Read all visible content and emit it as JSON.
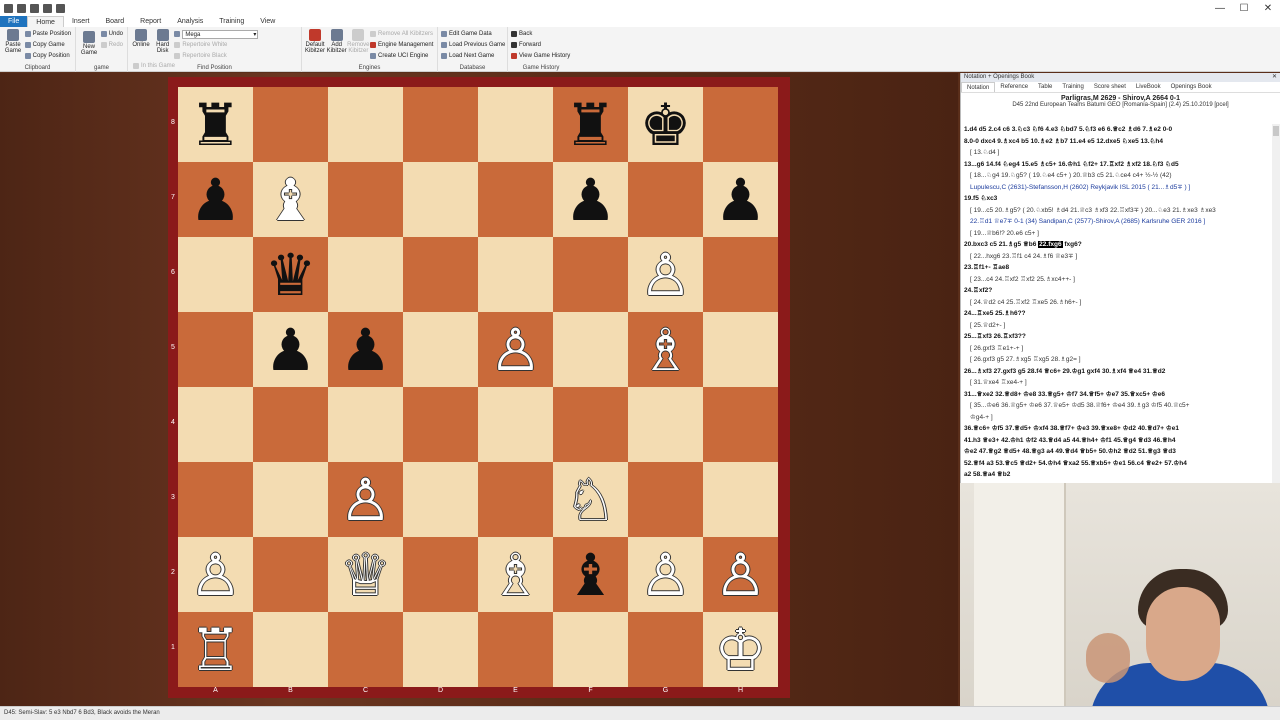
{
  "ribbon": {
    "tabs": [
      "File",
      "Home",
      "Insert",
      "Board",
      "Report",
      "Analysis",
      "Training",
      "View"
    ],
    "clipboard": {
      "paste_game": "Paste Game",
      "paste_position": "Paste Position",
      "copy_game": "Copy Game",
      "copy_position": "Copy Position",
      "label": "Clipboard"
    },
    "game": {
      "undo": "Undo",
      "redo": "Redo",
      "new_game": "New Game",
      "label": "game"
    },
    "find": {
      "online": "Online",
      "hard_disk": "Hard Disk",
      "database_select": "Mega",
      "in_this_game": "In this Game",
      "repertoire_white": "Repertoire White",
      "repertoire_black": "Repertoire Black",
      "label": "Find Position"
    },
    "engines": {
      "default_kibitzer": "Default Kibitzer",
      "add_kibitzer": "Add Kibitzer",
      "remove_kibitzer": "Remove Kibitzer",
      "remove_all": "Remove All Kibitzers",
      "engine_management": "Engine Management",
      "create_uci": "Create UCI Engine",
      "label": "Engines"
    },
    "database": {
      "edit_game_data": "Edit Game Data",
      "load_previous": "Load Previous Game",
      "load_next": "Load Next Game",
      "label": "Database"
    },
    "history": {
      "back": "Back",
      "forward": "Forward",
      "view_history": "View Game History",
      "label": "Game History"
    }
  },
  "board": {
    "ranks": [
      "8",
      "7",
      "6",
      "5",
      "4",
      "3",
      "2",
      "1"
    ],
    "files": [
      "A",
      "B",
      "C",
      "D",
      "E",
      "F",
      "G",
      "H"
    ],
    "pieces": [
      {
        "sq": "a8",
        "glyph": "♜",
        "color": "b"
      },
      {
        "sq": "f8",
        "glyph": "♜",
        "color": "b"
      },
      {
        "sq": "g8",
        "glyph": "♚",
        "color": "b"
      },
      {
        "sq": "a7",
        "glyph": "♟",
        "color": "b"
      },
      {
        "sq": "b7",
        "glyph": "♝",
        "color": "w"
      },
      {
        "sq": "f7",
        "glyph": "♟",
        "color": "b"
      },
      {
        "sq": "h7",
        "glyph": "♟",
        "color": "b"
      },
      {
        "sq": "b6",
        "glyph": "♛",
        "color": "b"
      },
      {
        "sq": "g6",
        "glyph": "♙",
        "color": "w"
      },
      {
        "sq": "b5",
        "glyph": "♟",
        "color": "b"
      },
      {
        "sq": "c5",
        "glyph": "♟",
        "color": "b"
      },
      {
        "sq": "e5",
        "glyph": "♙",
        "color": "w"
      },
      {
        "sq": "g5",
        "glyph": "♗",
        "color": "w"
      },
      {
        "sq": "c3",
        "glyph": "♙",
        "color": "w"
      },
      {
        "sq": "f3",
        "glyph": "♘",
        "color": "w"
      },
      {
        "sq": "a2",
        "glyph": "♙",
        "color": "w"
      },
      {
        "sq": "c2",
        "glyph": "♕",
        "color": "w"
      },
      {
        "sq": "e2",
        "glyph": "♗",
        "color": "w"
      },
      {
        "sq": "f2",
        "glyph": "♝",
        "color": "b"
      },
      {
        "sq": "g2",
        "glyph": "♙",
        "color": "w"
      },
      {
        "sq": "h2",
        "glyph": "♙",
        "color": "w"
      },
      {
        "sq": "a1",
        "glyph": "♖",
        "color": "w"
      },
      {
        "sq": "h1",
        "glyph": "♔",
        "color": "w"
      }
    ]
  },
  "notation": {
    "panel_title": "Notation + Openings Book",
    "tabs": [
      "Notation",
      "Reference",
      "Table",
      "Training",
      "Score sheet",
      "LiveBook",
      "Openings Book"
    ],
    "header": "Parligras,M 2629 - Shirov,A 2664  0-1",
    "event": "D45  22nd European Teams Batumi GEO [Romania-Spain] (2.4) 25.10.2019 [pcel]",
    "lines": [
      {
        "kind": "mv",
        "text": "1.d4  d5  2.c4  c6  3.♘c3  ♘f6  4.e3  ♘bd7  5.♘f3  e6  6.♕c2  ♗d6  7.♗e2  0-0"
      },
      {
        "kind": "mv",
        "text": "8.0-0  dxc4  9.♗xc4  b5  10.♗e2  ♗b7  11.e4  e5  12.dxe5  ♘xe5  13.♘h4"
      },
      {
        "kind": "var",
        "text": "[ 13.♘d4 ]"
      },
      {
        "kind": "mv",
        "text": "13...g6  14.f4  ♘eg4  15.e5  ♗c5+  16.♔h1  ♘f2+  17.♖xf2  ♗xf2  18.♘f3  ♘d5"
      },
      {
        "kind": "var",
        "text": "[ 18...♘g4  19.♘g5?  ( 19.♘e4  c5+ )  20.♕b3  c5  21.♘ce4  c4+ ½-½ (42)"
      },
      {
        "kind": "varblue",
        "text": "Lupulescu,C (2631)-Stefansson,H (2602) Reykjavik ISL 2015  ( 21...♗d5∓ ) ]"
      },
      {
        "kind": "mv",
        "text": "19.f5  ♘xc3"
      },
      {
        "kind": "var",
        "text": "[ 19...c5  20.♗g5?  ( 20.♘xb5!  ♗d4  21.♕c3  ♗xf3  22.♖xf3∓ )  20...♘e3  21.♗xe3  ♗xe3"
      },
      {
        "kind": "varblue",
        "text": "22.♖d1  ♕e7∓ 0-1 (34) Sandipan,C (2577)-Shirov,A (2685) Karlsruhe GER 2016 ]"
      },
      {
        "kind": "var",
        "text": "[ 19...♕b6!?  20.e6  c5+ ]"
      },
      {
        "kind": "mvhl",
        "pre": "20.bxc3  c5  21.♗g5  ♕b6  ",
        "hl": "22.fxg6",
        "post": "  fxg6?"
      },
      {
        "kind": "var",
        "text": "[ 22...hxg6  23.♖f1  c4  24.♗f6  ♕e3∓ ]"
      },
      {
        "kind": "mv",
        "text": "23.♖f1+-  ♖ae8"
      },
      {
        "kind": "var",
        "text": "[ 23...c4  24.♖xf2  ♖xf2  25.♗xc4++- ]"
      },
      {
        "kind": "mv",
        "text": "24.♖xf2?"
      },
      {
        "kind": "var",
        "text": "[ 24.♕d2  c4  25.♖xf2  ♖xe5  26.♗h6+- ]"
      },
      {
        "kind": "mv",
        "text": "24...♖xe5  25.♗h6??"
      },
      {
        "kind": "var",
        "text": "[ 25.♕d2+- ]"
      },
      {
        "kind": "mv",
        "text": "25...♖xf3  26.♖xf3??"
      },
      {
        "kind": "var",
        "text": "[ 26.gxf3  ♖e1+-+ ]"
      },
      {
        "kind": "var",
        "text": "[ 26.gxf3  g5  27.♗xg5  ♖xg5  28.♗g2= ]"
      },
      {
        "kind": "mv",
        "text": "26...♗xf3  27.gxf3  g5  28.f4  ♕c6+  29.♔g1  gxf4  30.♗xf4  ♕e4  31.♕d2"
      },
      {
        "kind": "var",
        "text": "[ 31.♕xe4  ♖xe4-+ ]"
      },
      {
        "kind": "mv",
        "text": "31...♕xe2  32.♕d8+  ♔e8  33.♕g5+  ♔f7  34.♕f5+  ♔e7  35.♕xc5+  ♔e6"
      },
      {
        "kind": "var",
        "text": "[ 35...♔e6  36.♕g5+  ♔e6  37.♕e5+  ♔d5  38.♕f6+  ♔e4  39.♗g3  ♔f5  40.♕c5+"
      },
      {
        "kind": "var",
        "text": "♔g4-+ ]"
      },
      {
        "kind": "mv",
        "text": "36.♕c6+  ♔f5  37.♕d5+  ♔xf4  38.♕f7+  ♔e3  39.♕xe8+  ♔d2  40.♕d7+  ♔e1"
      },
      {
        "kind": "mv",
        "text": "41.h3  ♕e3+  42.♔h1  ♔f2  43.♕d4  a5  44.♕h4+  ♔f1  45.♕g4  ♕d3  46.♕h4"
      },
      {
        "kind": "mv",
        "text": "♔e2  47.♕g2  ♕d5+  48.♕g3  a4  49.♕d4  ♕b5+  50.♔h2  ♕d2  51.♕g3  ♕d3"
      },
      {
        "kind": "mv",
        "text": "52.♕f4  a3  53.♕c5  ♕d2+  54.♔h4  ♕xa2  55.♕xb5+  ♔e1  56.c4  ♕e2+  57.♔h4"
      },
      {
        "kind": "mv",
        "text": "a2  58.♕a4  ♕b2"
      }
    ]
  },
  "status": {
    "text": "D45: Semi-Slav: 5 e3 Nbd7 6 Bd3, Black avoids the Meran"
  },
  "colors": {
    "light_square": "#f3dcb2",
    "dark_square": "#c96a3a",
    "frame": "#8b1a1a",
    "file_tab": "#1e73be"
  }
}
